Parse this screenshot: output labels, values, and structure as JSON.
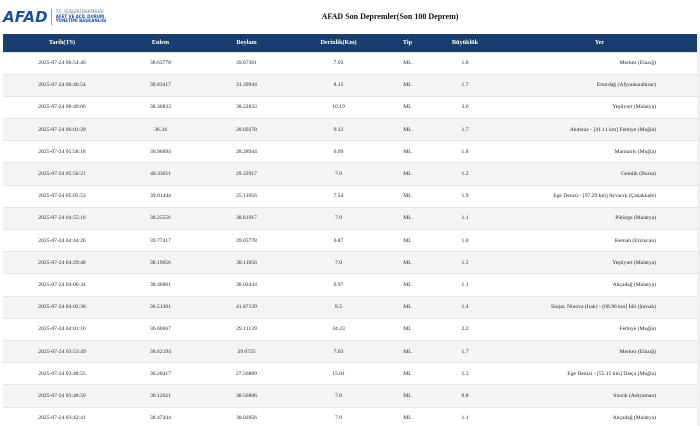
{
  "header": {
    "logo_text": "AFAD",
    "logo_sub_1": "T.C. İÇİŞLERİ BAKANLIĞI",
    "logo_sub_2": "AFET VE ACİL DURUM",
    "logo_sub_3": "YÖNETİMİ BAŞKANLIĞI",
    "title": "AFAD Son Depremler(Son 100 Deprem)"
  },
  "table": {
    "columns": [
      "Tarih(TS)",
      "Enlem",
      "Boylam",
      "Derinlik(Km)",
      "Tip",
      "Büyüklük",
      "Yer"
    ],
    "rows": [
      [
        "2025-07-24 06:54:46",
        "38.63778",
        "39.67361",
        "7.03",
        "ML",
        "1.8",
        "Merkez (Elazığ)"
      ],
      [
        "2025-07-24 06:46:54",
        "38.83417",
        "31.39944",
        "8.15",
        "ML",
        "1.7",
        "Emirdağ (Afyonkarahisar)"
      ],
      [
        "2025-07-24 06:40:06",
        "38.30833",
        "38.22833",
        "10.19",
        "ML",
        "3.6",
        "Yeşilyurt (Malatya)"
      ],
      [
        "2025-07-24 06:01:39",
        "36.34",
        "28.69278",
        "9.12",
        "ML",
        "1.7",
        "Akdeniz - [41.11 km] Fethiye (Muğla)"
      ],
      [
        "2025-07-24 05:58:18",
        "36.96694",
        "28.28944",
        "6.99",
        "ML",
        "1.8",
        "Marmaris (Muğla)"
      ],
      [
        "2025-07-24 05:56:21",
        "40.33611",
        "29.33917",
        "7.0",
        "ML",
        "1.2",
        "Gemlik (Bursa)"
      ],
      [
        "2025-07-24 05:05:53",
        "39.01444",
        "25.11056",
        "7.54",
        "ML",
        "1.9",
        "Ege Denizi - [97.29 km] Ayvacık (Çanakkale)"
      ],
      [
        "2025-07-24 04:55:16",
        "38.25556",
        "38.81917",
        "7.0",
        "ML",
        "1.1",
        "Pütürge (Malatya)"
      ],
      [
        "2025-07-24 04:44:26",
        "39.77417",
        "39.05778",
        "6.87",
        "ML",
        "1.0",
        "Kemah (Erzincan)"
      ],
      [
        "2025-07-24 04:29:48",
        "38.19056",
        "38.11056",
        "7.0",
        "ML",
        "1.5",
        "Yeşilyurt (Malatya)"
      ],
      [
        "2025-07-24 04:06:34",
        "38.46861",
        "38.02444",
        "6.97",
        "ML",
        "1.1",
        "Akçadağ (Malatya)"
      ],
      [
        "2025-07-24 04:02:36",
        "36.51361",
        "41.87139",
        "8.5",
        "ML",
        "1.4",
        "Sinjar, Ninova (Irak) - [68.96 km] İdil (Şırnak)"
      ],
      [
        "2025-07-24 04:01:16",
        "36.66667",
        "29.11139",
        "34.23",
        "ML",
        "2.2",
        "Fethiye (Muğla)"
      ],
      [
        "2025-07-24 03:53:49",
        "38.62194",
        "39.6725",
        "7.03",
        "ML",
        "1.7",
        "Merkez (Elazığ)"
      ],
      [
        "2025-07-24 03:48:55",
        "36.20417",
        "27.56889",
        "15.01",
        "ML",
        "1.3",
        "Ege Denizi - [55.15 km] Datça (Muğla)"
      ],
      [
        "2025-07-24 03:48:50",
        "38.12611",
        "38.56806",
        "7.0",
        "ML",
        "0.8",
        "Sincik (Adıyaman)"
      ],
      [
        "2025-07-24 03:42:41",
        "38.47444",
        "38.02056",
        "7.0",
        "ML",
        "1.1",
        "Akçadağ (Malatya)"
      ]
    ]
  },
  "colors": {
    "header_bg": "#183d6f",
    "brand_blue": "#1d4f9c",
    "row_alt": "#f4f4f4"
  }
}
